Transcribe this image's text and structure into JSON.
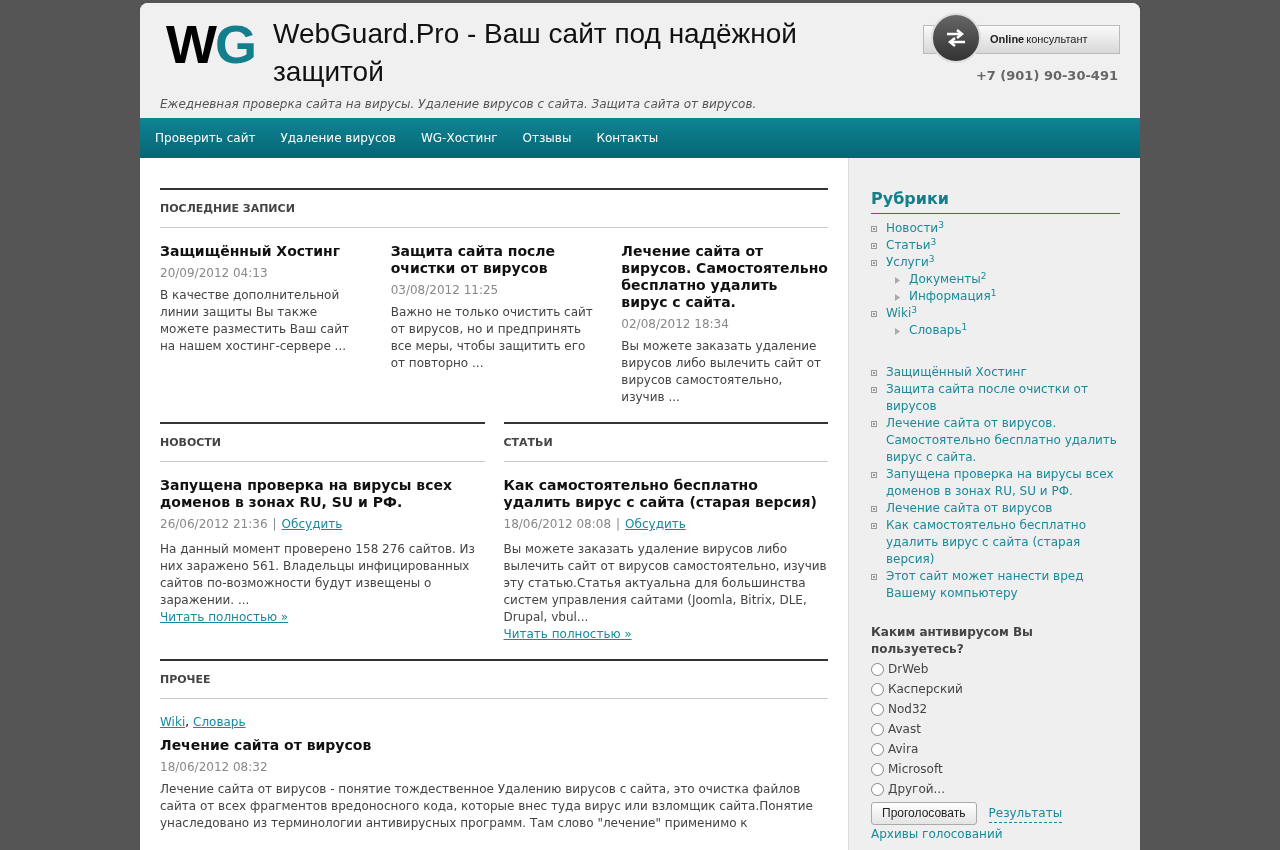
{
  "header": {
    "logo_letters": [
      "W",
      "G"
    ],
    "title": "WebGuard.Pro - Ваш сайт под надёжной защитой",
    "tagline": "Ежедневная проверка сайта на вирусы. Удаление вирусов с сайта. Защита сайта от вирусов.",
    "consultant": {
      "bold": "Online",
      "rest": "консультант"
    },
    "phone": "+7 (901) 90-30-491"
  },
  "nav": [
    "Проверить сайт",
    "Удаление вирусов",
    "WG-Хостинг",
    "Отзывы",
    "Контакты"
  ],
  "latest": {
    "heading": "ПОСЛЕДНИЕ ЗАПИСИ",
    "posts": [
      {
        "title": "Защищённый Хостинг",
        "date": "20/09/2012 04:13",
        "excerpt": "В качестве дополнительной линии защиты Вы также можете разместить Ваш сайт на нашем хостинг-сервере ..."
      },
      {
        "title": "Защита сайта после очистки от вирусов",
        "date": "03/08/2012 11:25",
        "excerpt": "Важно не только очистить сайт от вирусов, но и предпринять все меры, чтобы защитить его от повторно ..."
      },
      {
        "title": "Лечение сайта от вирусов. Самостоятельно бесплатно удалить вирус с сайта.",
        "date": "02/08/2012 18:34",
        "excerpt": "Вы можете заказать удаление вирусов либо вылечить сайт от вирусов самостоятельно, изучив ..."
      }
    ]
  },
  "columns": [
    {
      "heading": "НОВОСТИ",
      "title": "Запущена проверка на вирусы всех доменов в зонах RU, SU и РФ.",
      "date": "26/06/2012 21:36",
      "separator": "|",
      "comment_link": "Обсудить",
      "excerpt": "На данный момент проверено 158 276 сайтов. Из них заражено 561. Владельцы инфицированных сайтов по-возможности будут извещены о заражении.  ...",
      "read_more": "Читать полностью »"
    },
    {
      "heading": "СТАТЬИ",
      "title": "Как самостоятельно бесплатно удалить вирус с сайта (старая версия)",
      "date": "18/06/2012 08:08",
      "separator": "|",
      "comment_link": "Обсудить",
      "excerpt": "Вы можете заказать удаление вирусов либо вылечить сайт от вирусов самостоятельно, изучив эту статью.Статья  актуальна для большинства систем управления сайтами (Joomla, Bitrix, DLE, Drupal, vbul...",
      "read_more": "Читать полностью »"
    }
  ],
  "other": {
    "heading": "ПРОЧЕЕ",
    "tags": [
      "Wiki",
      "Словарь"
    ],
    "tag_separator": ",",
    "title": "Лечение сайта от вирусов",
    "date": "18/06/2012 08:32",
    "body": "Лечение сайта от вирусов - понятие тождественное Удалению вирусов с сайта, это очистка файлов сайта от всех фрагментов вредоносного кода, которые внес туда вирус или взломщик сайта.Понятие унаследовано из терминологии антивирусных программ. Там слово \"лечение\" применимо к"
  },
  "sidebar": {
    "categories": {
      "title": "Рубрики",
      "items": [
        {
          "label": "Новости",
          "count": "3"
        },
        {
          "label": "Статьи",
          "count": "3"
        },
        {
          "label": "Услуги",
          "count": "3",
          "children": [
            {
              "label": "Документы",
              "count": "2"
            },
            {
              "label": "Информация",
              "count": "1"
            }
          ]
        },
        {
          "label": "Wiki",
          "count": "3",
          "children": [
            {
              "label": "Словарь",
              "count": "1"
            }
          ]
        }
      ]
    },
    "recent": [
      "Защищённый Хостинг",
      "Защита сайта после очистки от вирусов",
      "Лечение сайта от вирусов. Самостоятельно бесплатно удалить вирус с сайта.",
      "Запущена проверка на вирусы всех доменов в зонах RU, SU и РФ.",
      "Лечение сайта от вирусов",
      "Как самостоятельно бесплатно удалить вирус с сайта (старая версия)",
      "Этот сайт может нанести вред Вашему компьютеру"
    ],
    "poll": {
      "question": "Каким антивирусом Вы пользуетесь?",
      "options": [
        {
          "label": "DrWeb",
          "selected": false
        },
        {
          "label": "Касперский",
          "selected": false
        },
        {
          "label": "Nod32",
          "selected": false
        },
        {
          "label": "Avast",
          "selected": false
        },
        {
          "label": "Avira",
          "selected": false
        },
        {
          "label": "Microsoft",
          "selected": false
        },
        {
          "label": "Другой...",
          "selected": false
        }
      ],
      "vote_button": "Проголосовать",
      "results_link": "Результаты",
      "archive_link": "Архивы голосований"
    }
  }
}
